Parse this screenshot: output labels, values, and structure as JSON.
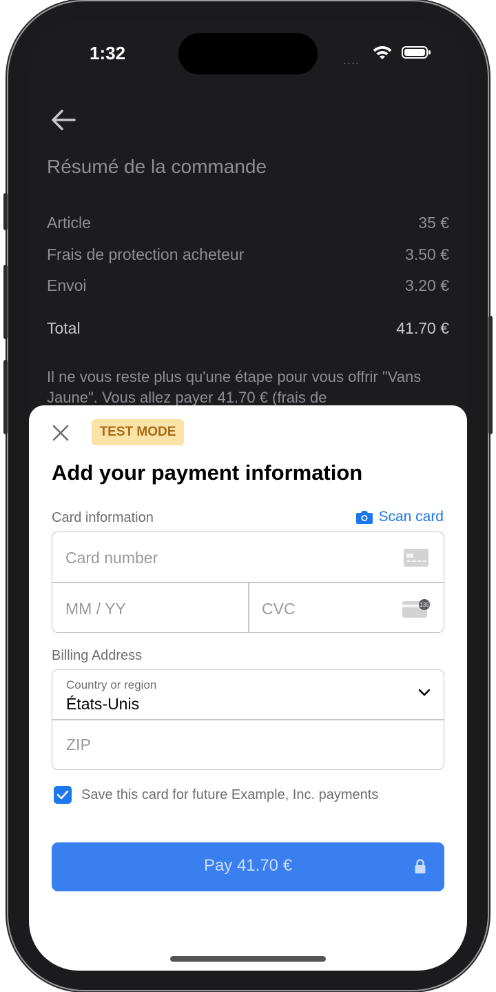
{
  "status_bar": {
    "time": "1:32",
    "signal": "...."
  },
  "order_summary": {
    "title": "Résumé de la commande",
    "lines": [
      {
        "label": "Article",
        "value": "35 €"
      },
      {
        "label": "Frais de protection acheteur",
        "value": "3.50 €"
      },
      {
        "label": "Envoi",
        "value": "3.20 €"
      }
    ],
    "total": {
      "label": "Total",
      "value": "41.70 €"
    },
    "note": "Il ne vous reste plus qu'une étape pour vous offrir \"Vans Jaune\". Vous allez payer 41.70 € (frais de"
  },
  "sheet": {
    "badge": "TEST MODE",
    "title": "Add your payment information",
    "card_section_label": "Card information",
    "scan_card_label": "Scan card",
    "card_number_placeholder": "Card number",
    "expiry_placeholder": "MM / YY",
    "cvc_placeholder": "CVC",
    "cvc_icon_text": "135",
    "billing_label": "Billing Address",
    "country_label": "Country or region",
    "country_value": "États-Unis",
    "zip_placeholder": "ZIP",
    "save_card_label": "Save this card for future Example, Inc. payments",
    "save_card_checked": true,
    "pay_label": "Pay 41.70 €"
  },
  "colors": {
    "accent": "#3a7ff0",
    "link": "#1c76ed",
    "badge_bg": "#fbe2a6",
    "badge_text": "#a56b17",
    "dark_bg": "#1c1c1e"
  }
}
